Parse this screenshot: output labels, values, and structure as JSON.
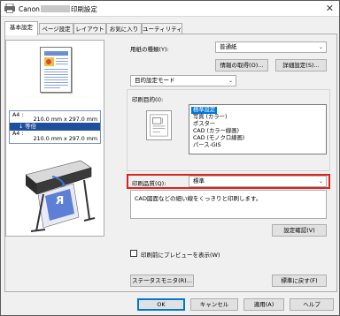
{
  "window": {
    "title_prefix": "Canon",
    "title_suffix": "印刷設定",
    "close_glyph": "✕"
  },
  "tabs": [
    {
      "label": "基本設定",
      "active": true
    },
    {
      "label": "ページ設定",
      "active": false
    },
    {
      "label": "レイアウト",
      "active": false
    },
    {
      "label": "お気に入り",
      "active": false
    },
    {
      "label": "ユーティリティ",
      "active": false
    }
  ],
  "preview": {
    "input_size_label": "A4 :",
    "input_size_value": "210.0 mm x 297.0 mm",
    "scale_label": "等倍",
    "output_size_label": "A4 :",
    "output_size_value": "210.0 mm x 297.0 mm",
    "printer_sheet_glyph": "R"
  },
  "media": {
    "label": "用紙の種類(Y):",
    "value": "普通紙",
    "get_info_button": "情報の取得(O)...",
    "details_button": "詳細設定(S)..."
  },
  "mode": {
    "value": "目的設定モード"
  },
  "purpose": {
    "label": "印刷目的(I):",
    "items": [
      {
        "label": "標準設定",
        "selected": true
      },
      {
        "label": "写真 (カラー)",
        "selected": false
      },
      {
        "label": "ポスター",
        "selected": false
      },
      {
        "label": "CAD (カラー線画)",
        "selected": false
      },
      {
        "label": "CAD (モノクロ線画)",
        "selected": false
      },
      {
        "label": "パース-GIS",
        "selected": false
      }
    ]
  },
  "quality": {
    "label": "印刷品質(Q):",
    "value": "標準",
    "description": "CAD図面などの細い線をくっきりと印刷します。",
    "confirm_button": "設定確認(V)"
  },
  "preview_checkbox": {
    "label": "印刷前にプレビューを表示(W)",
    "checked": false
  },
  "status_monitor_button": "ステータスモニタ(R)...",
  "reset_button": "標準に戻す(F)",
  "footer": {
    "ok": "OK",
    "cancel": "キャンセル",
    "apply": "適用(A)",
    "help": "ヘルプ"
  },
  "colors": {
    "accent": "#0078d7",
    "highlight_border": "#d9241e",
    "scale_bar": "#1e4f9c"
  }
}
